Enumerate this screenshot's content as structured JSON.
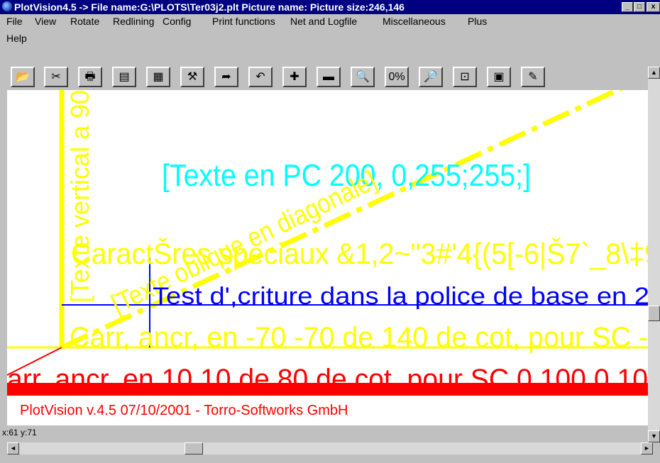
{
  "window": {
    "title": "PlotVision4.5 -> File name:G:\\PLOTS\\Ter03j2.plt Picture name: Picture size:246,146",
    "minimize": "_",
    "maximize": "□",
    "close": "x"
  },
  "menu": {
    "items": [
      "File",
      "View",
      "Rotate",
      "Redlining",
      "Config",
      "Print functions",
      "Net and Logfile",
      "Miscellaneous",
      "Plus",
      "Help"
    ]
  },
  "toolbar": {
    "buttons": [
      {
        "icon": "open-folder-icon",
        "glyph": "📂"
      },
      {
        "icon": "scissors-icon",
        "glyph": "✂"
      },
      {
        "icon": "printer-icon",
        "glyph": "🖶"
      },
      {
        "icon": "print-preview-icon",
        "glyph": "▤"
      },
      {
        "icon": "plotter-icon",
        "glyph": "▦"
      },
      {
        "icon": "tools-icon",
        "glyph": "⚒"
      },
      {
        "icon": "redo-arrow-icon",
        "glyph": "➦"
      },
      {
        "icon": "undo-arrow-icon",
        "glyph": "↶"
      },
      {
        "icon": "zoom-in-plus-icon",
        "glyph": "✚"
      },
      {
        "icon": "zoom-out-minus-icon",
        "glyph": "▬"
      },
      {
        "icon": "magnifier-icon",
        "glyph": "🔍"
      },
      {
        "icon": "percent-icon",
        "glyph": "0%"
      },
      {
        "icon": "search-key-icon",
        "glyph": "🔎"
      },
      {
        "icon": "fit-window-icon",
        "glyph": "⊡"
      },
      {
        "icon": "color-palette-icon",
        "glyph": "▣"
      },
      {
        "icon": "notes-icon",
        "glyph": "✎"
      }
    ]
  },
  "drawing": {
    "text_cyan": "[Texte en PC 200, 0,255;255;]",
    "text_vertical": "[Texte vertical a 90",
    "text_oblique": "[Texte oblique en diagonale]",
    "text_caracteres": "CaractŠres speciaux &1,2~\"3#'4{(5[-6|Š7`_8\\‡9",
    "text_test": "Test d',criture dans la police de base en 2",
    "text_carre_yellow": "Carr, ancr, en -70 -70 de 140 de cot, pour SC -",
    "text_carre_red": "arr, ancr, en 10 10 de 80 de cot, pour SC 0 100 0 10",
    "text_footer": "PlotVision v.4.5 07/10/2001 - Torro-Softworks GmbH",
    "colors": {
      "yellow": "#ffff00",
      "cyan": "#00ffff",
      "blue": "#0000ff",
      "red": "#ff0000"
    }
  },
  "status": {
    "coords": "x:61 y:71"
  },
  "scroll": {
    "up": "▲",
    "down": "▼",
    "left": "◄",
    "right": "►"
  }
}
